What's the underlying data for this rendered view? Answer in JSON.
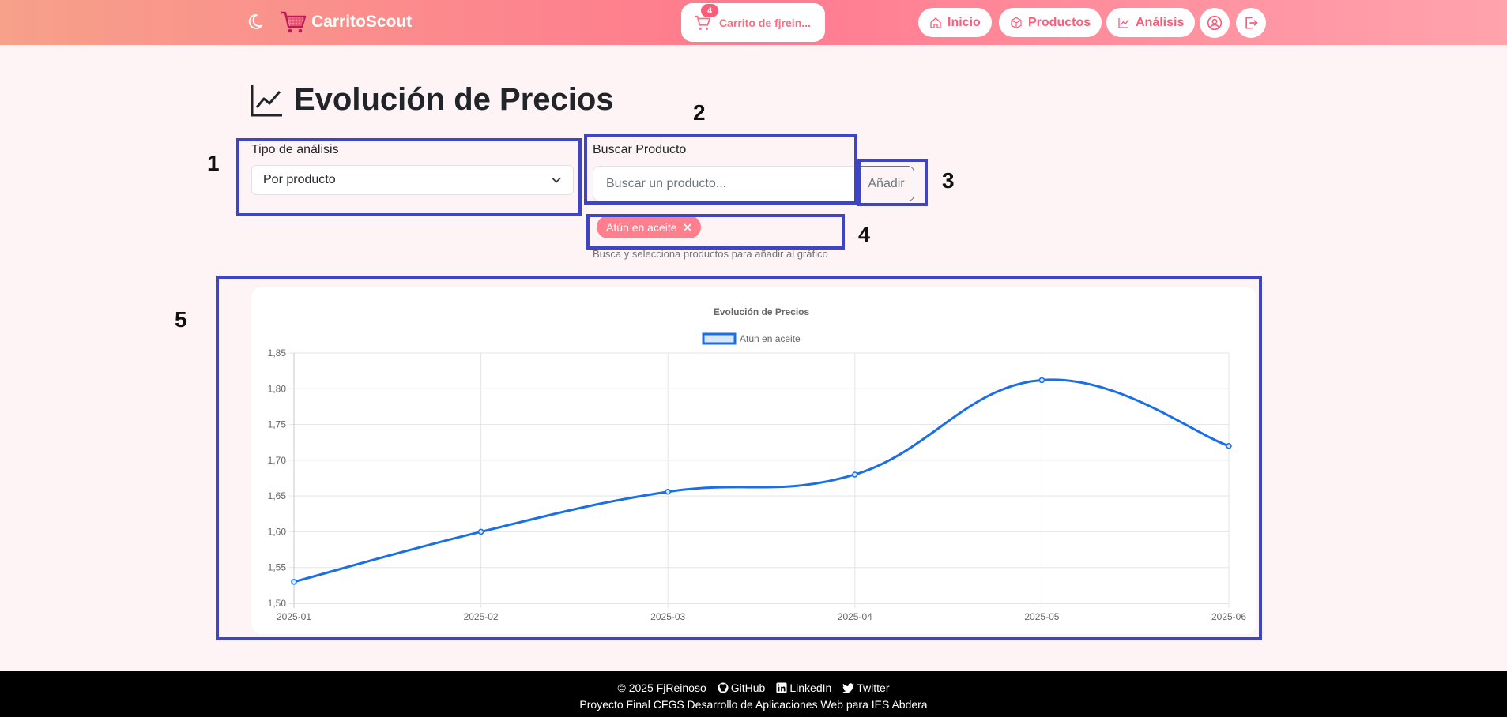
{
  "navbar": {
    "brand": "CarritoScout",
    "cart_label": "Carrito de fjrein...",
    "cart_badge": "4",
    "links": [
      {
        "label": "Inicio"
      },
      {
        "label": "Productos"
      },
      {
        "label": "Análisis"
      }
    ],
    "colors": {
      "gradient_start": "#f7a08a",
      "gradient_mid": "#ff7a8f",
      "accent": "#ff5c7a"
    }
  },
  "page": {
    "title": "Evolución de Precios",
    "analysis_type": {
      "label": "Tipo de análisis",
      "value": "Por producto"
    },
    "search": {
      "label": "Buscar Producto",
      "placeholder": "Buscar un producto...",
      "button": "Añadir"
    },
    "selected_chip": "Atún en aceite",
    "help_text": "Busca y selecciona productos para añadir al gráfico"
  },
  "annotations": [
    "1",
    "2",
    "3",
    "4",
    "5"
  ],
  "chart_data": {
    "type": "line",
    "title": "Evolución de Precios",
    "categories": [
      "2025-01",
      "2025-02",
      "2025-03",
      "2025-04",
      "2025-05",
      "2025-06"
    ],
    "series": [
      {
        "name": "Atún en aceite",
        "values": [
          1.53,
          1.6,
          1.656,
          1.68,
          1.812,
          1.72
        ],
        "color": "#1a6fe6"
      }
    ],
    "yticks": [
      "1,85",
      "1,80",
      "1,75",
      "1,70",
      "1,65",
      "1,60",
      "1,55",
      "1,50"
    ],
    "ylim": [
      1.5,
      1.85
    ],
    "grid": true,
    "legend": "top"
  },
  "footer": {
    "copyright": "© 2025 FjReinoso",
    "github": "GitHub",
    "linkedin": "LinkedIn",
    "twitter": "Twitter",
    "subtitle": "Proyecto Final CFGS Desarrollo de Aplicaciones Web para IES Abdera"
  }
}
